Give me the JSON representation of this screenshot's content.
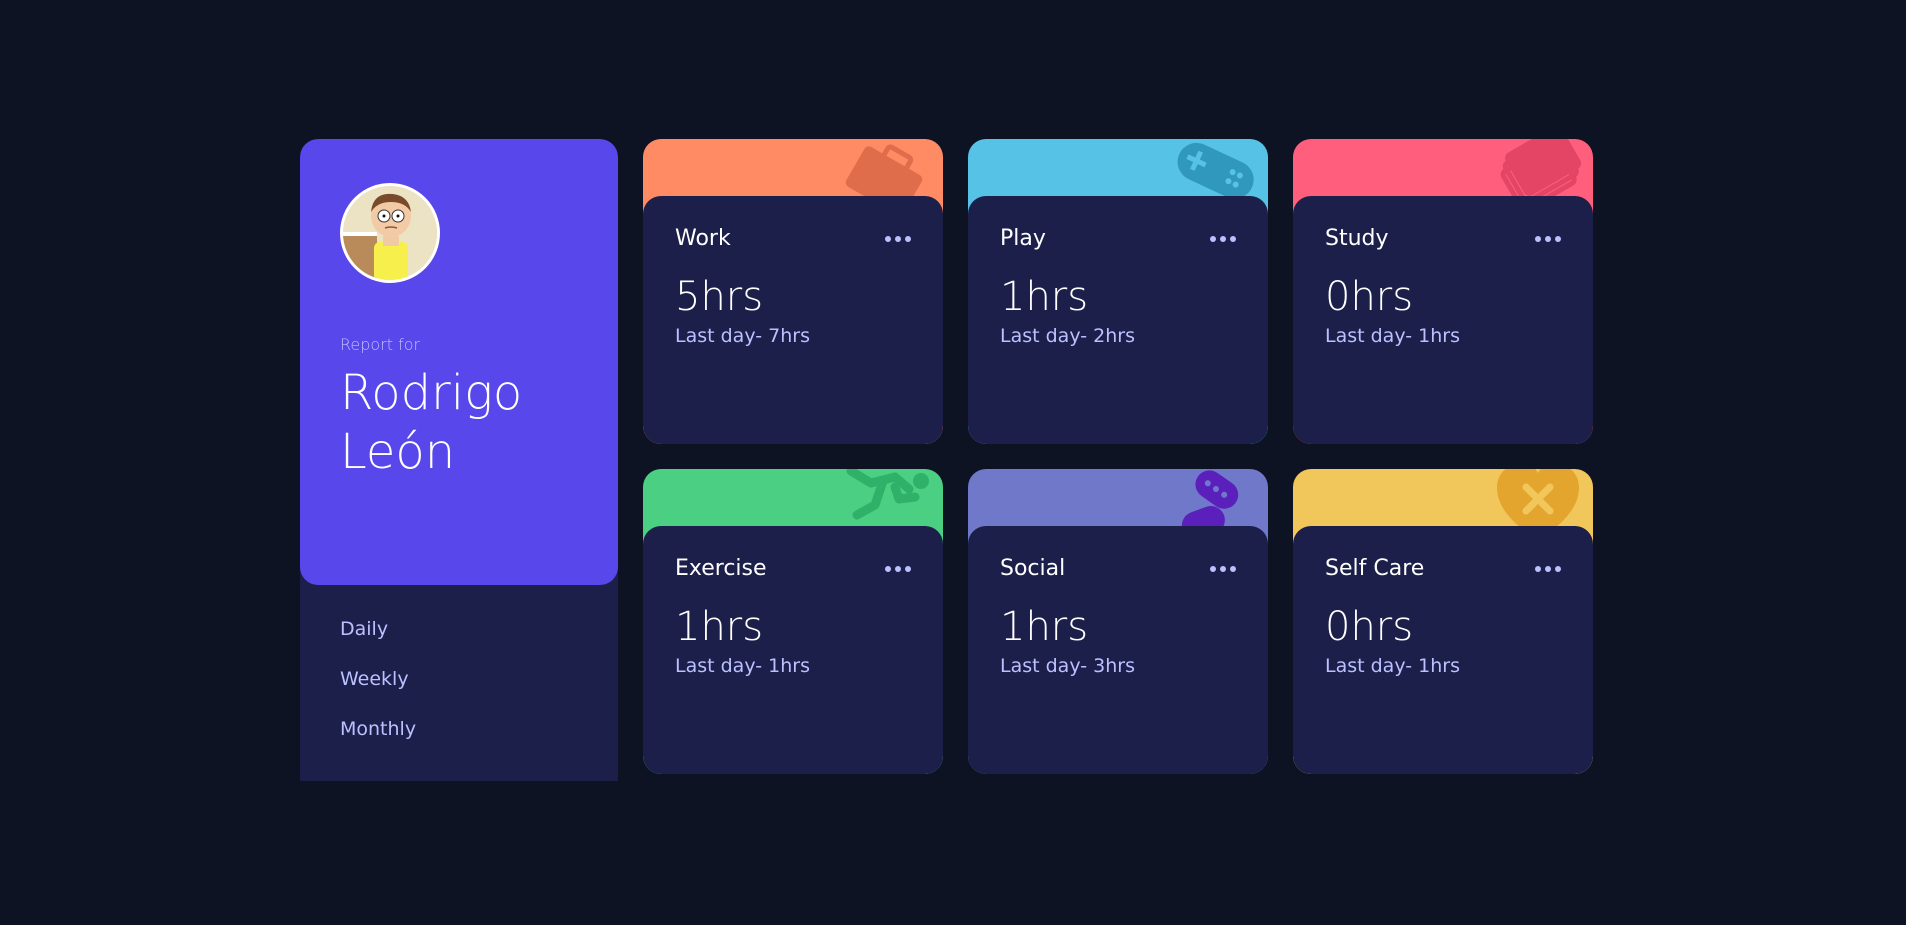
{
  "profile": {
    "report_for": "Report for",
    "name": "Rodrigo León",
    "timeframes": [
      "Daily",
      "Weekly",
      "Monthly"
    ]
  },
  "activities": [
    {
      "title": "Work",
      "current": "5hrs",
      "previous": "Last day- 7hrs",
      "color": "#ff8b64",
      "icon": "briefcase-icon"
    },
    {
      "title": "Play",
      "current": "1hrs",
      "previous": "Last day- 2hrs",
      "color": "#55c2e6",
      "icon": "gamepad-icon"
    },
    {
      "title": "Study",
      "current": "0hrs",
      "previous": "Last day- 1hrs",
      "color": "#ff5e7d",
      "icon": "book-icon"
    },
    {
      "title": "Exercise",
      "current": "1hrs",
      "previous": "Last day- 1hrs",
      "color": "#4bcf82",
      "icon": "running-icon"
    },
    {
      "title": "Social",
      "current": "1hrs",
      "previous": "Last day- 3hrs",
      "color": "#7335d2",
      "icon": "chat-icon"
    },
    {
      "title": "Self Care",
      "current": "0hrs",
      "previous": "Last day- 1hrs",
      "color": "#f1c75b",
      "icon": "heart-bandage-icon"
    }
  ],
  "colors": {
    "background": "#0e1323",
    "card": "#1c1f4a",
    "profile_accent": "#5847eb",
    "muted_text": "#bbc0ff"
  }
}
